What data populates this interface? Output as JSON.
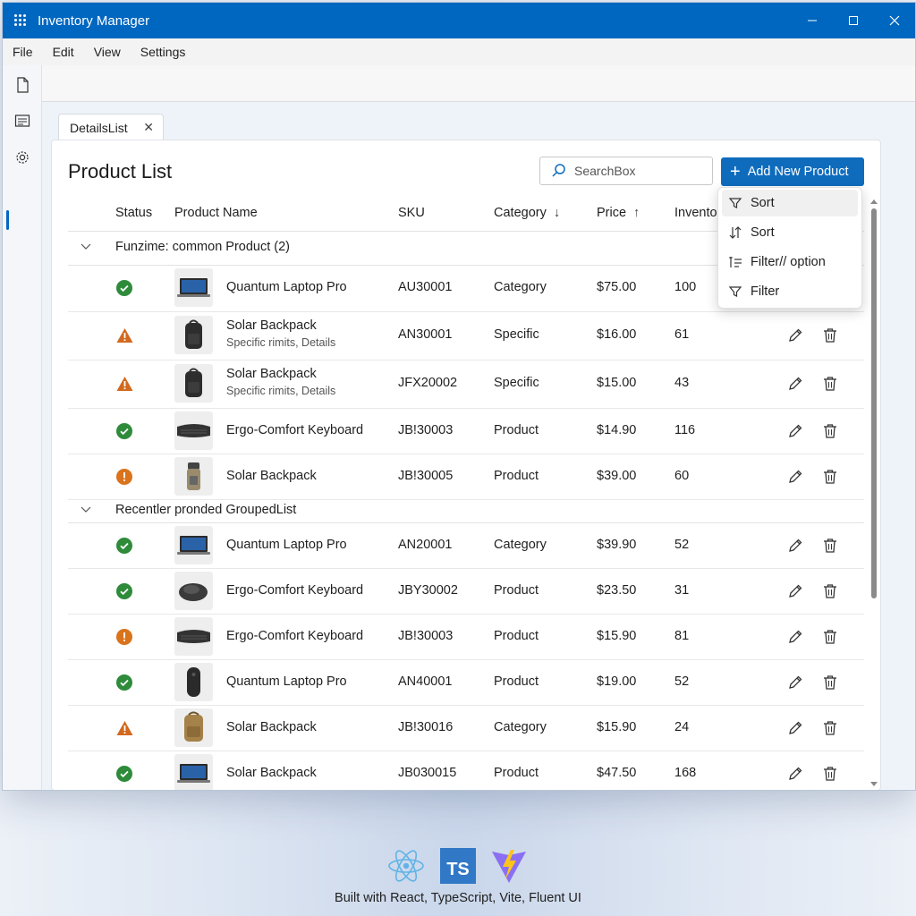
{
  "window": {
    "title": "Inventory Manager"
  },
  "menu": [
    "File",
    "Edit",
    "View",
    "Settings"
  ],
  "tab": {
    "label": "DetailsList"
  },
  "page": {
    "title": "Product List"
  },
  "search": {
    "placeholder": "SearchBox"
  },
  "add_button": {
    "label": "Add New Product"
  },
  "columns": {
    "status": "Status",
    "name": "Product Name",
    "sku": "SKU",
    "category": "Category",
    "price": "Price",
    "inventory": "Inventor"
  },
  "groups": [
    {
      "label": "Funzime: common Product (2)"
    },
    {
      "label": "Recentler pronded GroupedList"
    }
  ],
  "rows": [
    {
      "status": "ok",
      "thumb": "laptop-thumb",
      "name": "Quantum Laptop Pro",
      "sub": "",
      "sku": "AU30001",
      "category": "Category",
      "price": "$75.00",
      "inventory": "100"
    },
    {
      "status": "warning",
      "thumb": "backpack-thumb",
      "name": "Solar Backpack",
      "sub": "Specific rimits, Details",
      "sku": "AN30001",
      "category": "Specific",
      "price": "$16.00",
      "inventory": "61"
    },
    {
      "status": "warning",
      "thumb": "backpack-thumb",
      "name": "Solar Backpack",
      "sub": "Specific rimits, Details",
      "sku": "JFX20002",
      "category": "Specific",
      "price": "$15.00",
      "inventory": "43"
    },
    {
      "status": "ok",
      "thumb": "keyboard-thumb",
      "name": "Ergo-Comfort Keyboard",
      "sub": "",
      "sku": "JB!30003",
      "category": "Product",
      "price": "$14.90",
      "inventory": "116"
    },
    {
      "status": "error",
      "thumb": "bottle-thumb",
      "name": "Solar Backpack",
      "sub": "",
      "sku": "JB!30005",
      "category": "Product",
      "price": "$39.00",
      "inventory": "60"
    },
    {
      "status": "ok",
      "thumb": "laptop-thumb",
      "name": "Quantum Laptop Pro",
      "sub": "",
      "sku": "AN20001",
      "category": "Category",
      "price": "$39.90",
      "inventory": "52"
    },
    {
      "status": "ok",
      "thumb": "mouse-thumb",
      "name": "Ergo-Comfort Keyboard",
      "sub": "",
      "sku": "JBY30002",
      "category": "Product",
      "price": "$23.50",
      "inventory": "31"
    },
    {
      "status": "error",
      "thumb": "keyboard-thumb",
      "name": "Ergo-Comfort Keyboard",
      "sub": "",
      "sku": "JB!30003",
      "category": "Product",
      "price": "$15.90",
      "inventory": "81"
    },
    {
      "status": "ok",
      "thumb": "speaker-thumb",
      "name": "Quantum Laptop Pro",
      "sub": "",
      "sku": "AN40001",
      "category": "Product",
      "price": "$19.00",
      "inventory": "52"
    },
    {
      "status": "warning",
      "thumb": "backpack-tan-thumb",
      "name": "Solar Backpack",
      "sub": "",
      "sku": "JB!30016",
      "category": "Category",
      "price": "$15.90",
      "inventory": "24"
    },
    {
      "status": "ok",
      "thumb": "laptop-thumb",
      "name": "Solar Backpack",
      "sub": "",
      "sku": "JB030015",
      "category": "Product",
      "price": "$47.50",
      "inventory": "168"
    }
  ],
  "dropdown": {
    "items": [
      "Sort",
      "Sort",
      "Filter// option",
      "Filter"
    ]
  },
  "footer": {
    "text": "Built with React, TypeScript, Vite, Fluent UI",
    "ts_badge": "TS"
  },
  "colors": {
    "accent": "#0f6cbd",
    "titlebar": "#0067c0",
    "ok": "#2e8b3a",
    "warning": "#d2691e",
    "error": "#d9731c"
  }
}
